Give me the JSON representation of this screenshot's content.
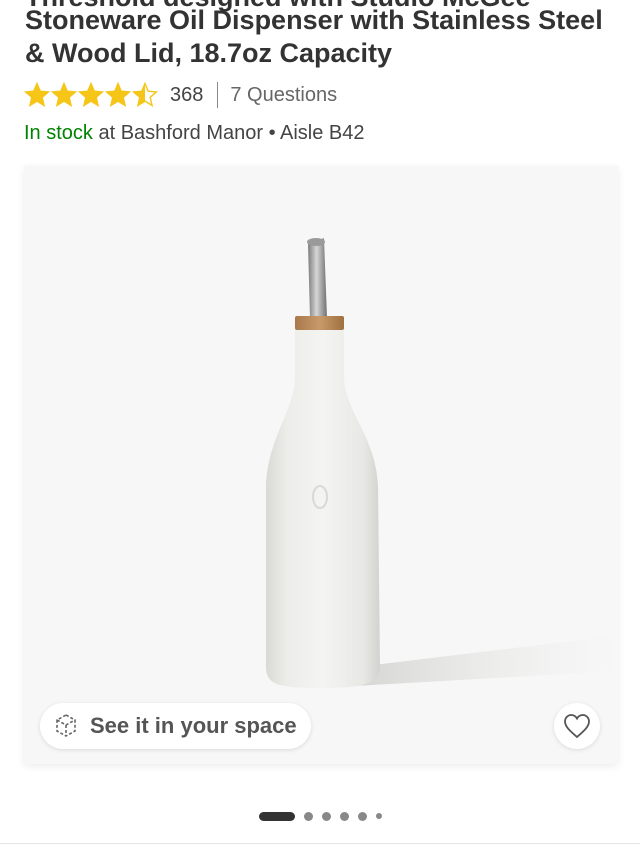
{
  "product": {
    "title": "Stoneware Oil Dispenser with Stainless Steel & Wood Lid, 18.7oz Capacity",
    "rating": 4.5,
    "rating_max": 5,
    "review_count": "368",
    "questions_label": "7 Questions"
  },
  "availability": {
    "status": "In stock",
    "location_text": " at Bashford Manor • Aisle B42",
    "status_color": "#008300"
  },
  "gallery": {
    "ar_label": "See it in your space",
    "total_images": 6,
    "active_index": 0
  },
  "colors": {
    "star": "#f5c518",
    "text": "#333333"
  },
  "icons": {
    "ar": "ar-cube-icon",
    "favorite": "heart-outline-icon",
    "star": "star-icon"
  }
}
